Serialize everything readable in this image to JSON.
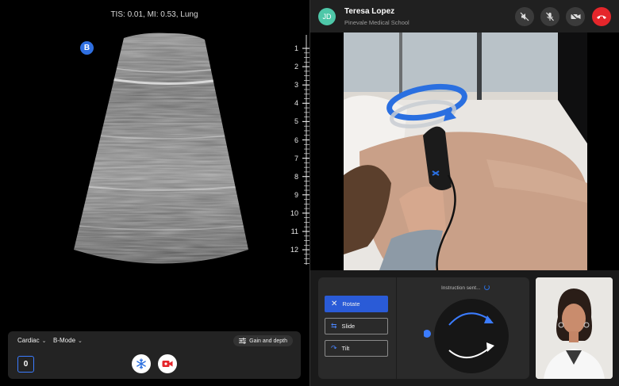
{
  "ultrasound": {
    "status_text": "TIS: 0.01, MI: 0.53, Lung",
    "probe_badge": "B",
    "depth_marks": [
      "1",
      "2",
      "3",
      "4",
      "5",
      "6",
      "7",
      "8",
      "9",
      "10",
      "11",
      "12"
    ]
  },
  "controls": {
    "preset": "Cardiac",
    "mode": "B-Mode",
    "gain_depth_label": "Gain and depth",
    "counter": "0",
    "icons": {
      "gain": "sliders-icon",
      "freeze": "snowflake-icon",
      "record": "video-camera-icon"
    }
  },
  "call": {
    "initials": "JD",
    "caller_name": "Teresa Lopez",
    "caller_org": "Pinevale Medical School",
    "header_icons": [
      "speaker-muted-icon",
      "mic-muted-icon",
      "video-off-icon",
      "hang-up-icon"
    ]
  },
  "instructions": {
    "buttons": [
      {
        "label": "Rotate",
        "icon": "x-icon",
        "active": true
      },
      {
        "label": "Slide",
        "icon": "arrows-horizontal-icon",
        "active": false
      },
      {
        "label": "Tilt",
        "icon": "arc-arrow-icon",
        "active": false
      }
    ],
    "status": "Instruction sent..."
  },
  "colors": {
    "accent_blue": "#2a5bd7",
    "hangup_red": "#e5262b",
    "avatar_green": "#4ec7a8"
  }
}
